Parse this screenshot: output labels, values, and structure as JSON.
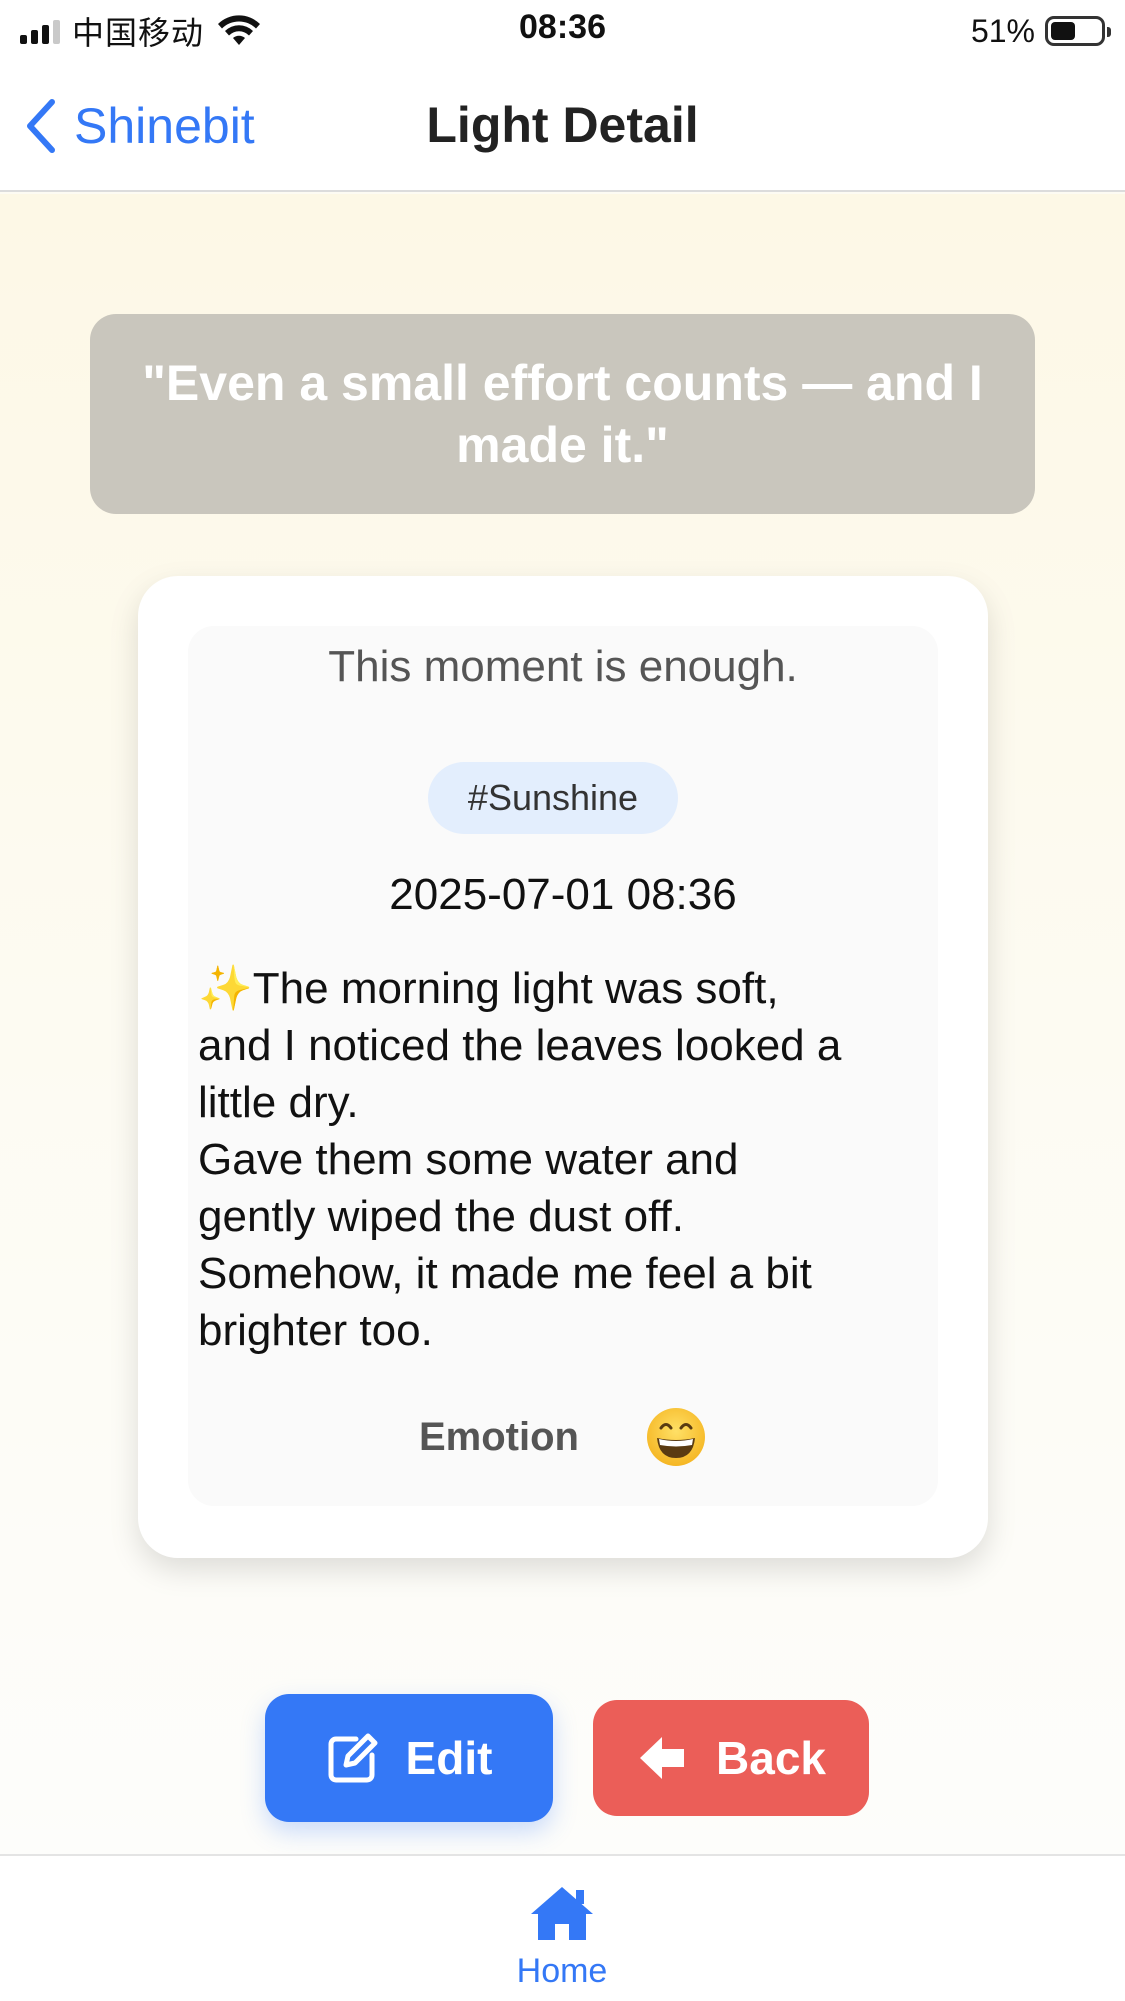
{
  "status_bar": {
    "carrier": "中国移动",
    "time": "08:36",
    "battery": "51%",
    "battery_level": 0.51
  },
  "nav": {
    "back_label": "Shinebit",
    "title": "Light Detail"
  },
  "quote": {
    "text": "\"Even a small effort counts — and I made it.\""
  },
  "card": {
    "subtitle": "This moment is enough.",
    "tag": "#Sunshine",
    "timestamp": "2025-07-01 08:36",
    "body_lines": [
      "✨The morning light was soft,",
      "and I noticed the leaves looked a",
      "little dry.",
      "Gave them some water and",
      "gently wiped the dust off.",
      "Somehow, it made me feel a bit",
      "brighter too."
    ],
    "emotion_label": "Emotion",
    "emotion_icon": "grinning-face-icon"
  },
  "actions": {
    "edit_label": "Edit",
    "back_label": "Back"
  },
  "tab_bar": {
    "home_label": "Home"
  },
  "colors": {
    "accent": "#3478f6",
    "danger": "#eb5e58",
    "quote_bg": "#c9c6bd",
    "tag_bg": "#e3eefd"
  }
}
